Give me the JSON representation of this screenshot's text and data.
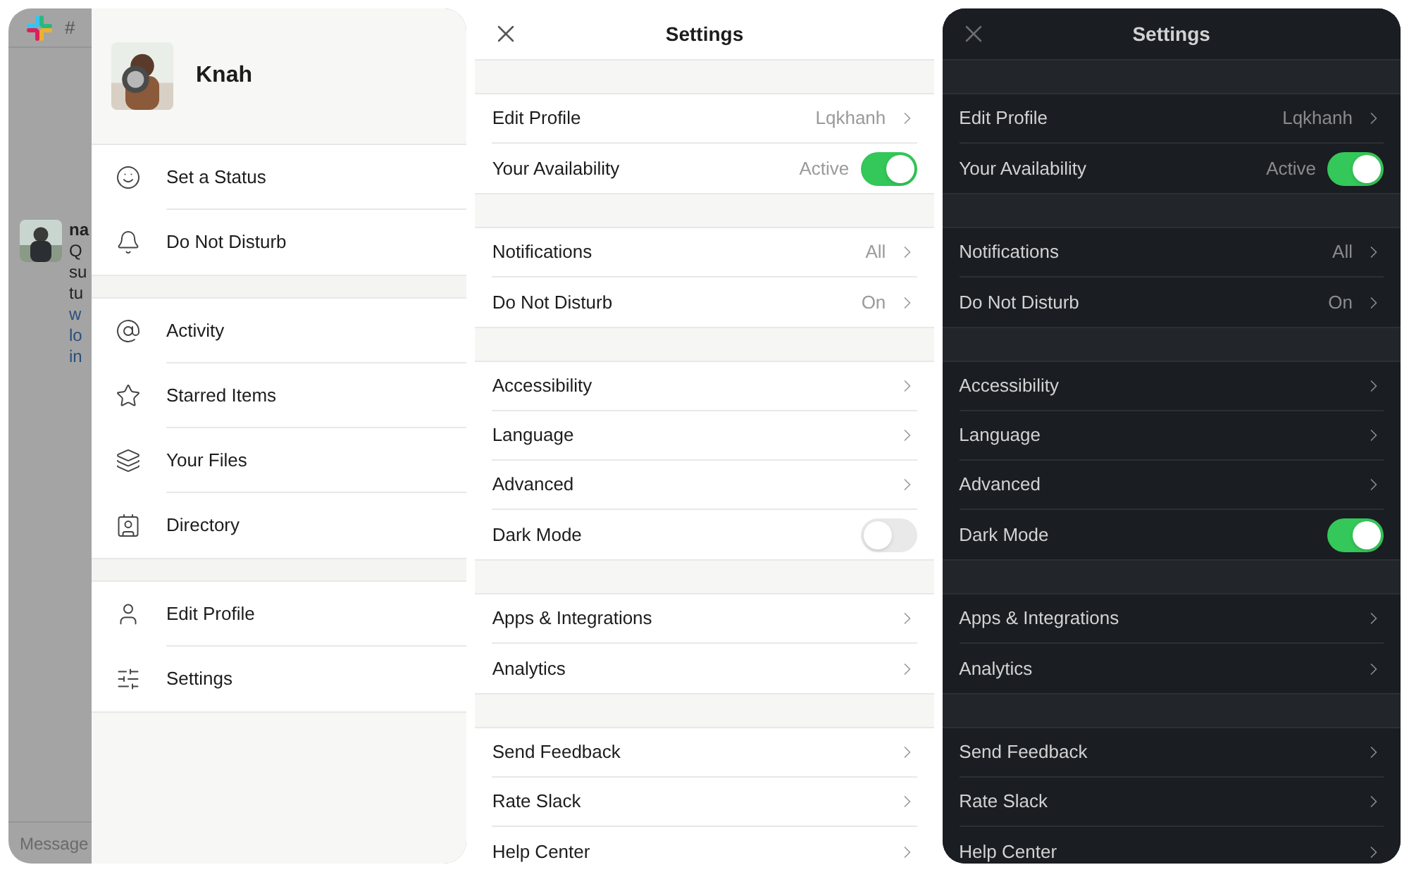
{
  "chat_background": {
    "channel": "#",
    "author": "na",
    "message_lines": [
      "Q",
      "su",
      "tu",
      "w",
      "lo",
      "in"
    ],
    "composer_placeholder": "Message"
  },
  "drawer": {
    "user_name": "Knah",
    "sections": [
      {
        "items": [
          "Set a Status",
          "Do Not Disturb"
        ]
      },
      {
        "items": [
          "Activity",
          "Starred Items",
          "Your Files",
          "Directory"
        ]
      },
      {
        "items": [
          "Edit Profile",
          "Settings"
        ]
      }
    ]
  },
  "settings_screens": [
    {
      "dark": false,
      "title": "Settings",
      "sections": [
        {
          "rows": [
            {
              "label": "Edit Profile",
              "value": "Lqkhanh",
              "kind": "link"
            },
            {
              "label": "Your Availability",
              "value": "Active",
              "kind": "toggle",
              "on": true
            }
          ]
        },
        {
          "rows": [
            {
              "label": "Notifications",
              "value": "All",
              "kind": "link"
            },
            {
              "label": "Do Not Disturb",
              "value": "On",
              "kind": "link"
            }
          ]
        },
        {
          "rows": [
            {
              "label": "Accessibility",
              "kind": "link"
            },
            {
              "label": "Language",
              "kind": "link"
            },
            {
              "label": "Advanced",
              "kind": "link"
            },
            {
              "label": "Dark Mode",
              "kind": "toggle",
              "on": false
            }
          ]
        },
        {
          "rows": [
            {
              "label": "Apps & Integrations",
              "kind": "link"
            },
            {
              "label": "Analytics",
              "kind": "link"
            }
          ]
        },
        {
          "rows": [
            {
              "label": "Send Feedback",
              "kind": "link"
            },
            {
              "label": "Rate Slack",
              "kind": "link"
            },
            {
              "label": "Help Center",
              "kind": "link"
            }
          ]
        }
      ]
    },
    {
      "dark": true,
      "title": "Settings",
      "sections": [
        {
          "rows": [
            {
              "label": "Edit Profile",
              "value": "Lqkhanh",
              "kind": "link"
            },
            {
              "label": "Your Availability",
              "value": "Active",
              "kind": "toggle",
              "on": true
            }
          ]
        },
        {
          "rows": [
            {
              "label": "Notifications",
              "value": "All",
              "kind": "link"
            },
            {
              "label": "Do Not Disturb",
              "value": "On",
              "kind": "link"
            }
          ]
        },
        {
          "rows": [
            {
              "label": "Accessibility",
              "kind": "link"
            },
            {
              "label": "Language",
              "kind": "link"
            },
            {
              "label": "Advanced",
              "kind": "link"
            },
            {
              "label": "Dark Mode",
              "kind": "toggle",
              "on": true
            }
          ]
        },
        {
          "rows": [
            {
              "label": "Apps & Integrations",
              "kind": "link"
            },
            {
              "label": "Analytics",
              "kind": "link"
            }
          ]
        },
        {
          "rows": [
            {
              "label": "Send Feedback",
              "kind": "link"
            },
            {
              "label": "Rate Slack",
              "kind": "link"
            },
            {
              "label": "Help Center",
              "kind": "link"
            }
          ]
        }
      ]
    }
  ]
}
